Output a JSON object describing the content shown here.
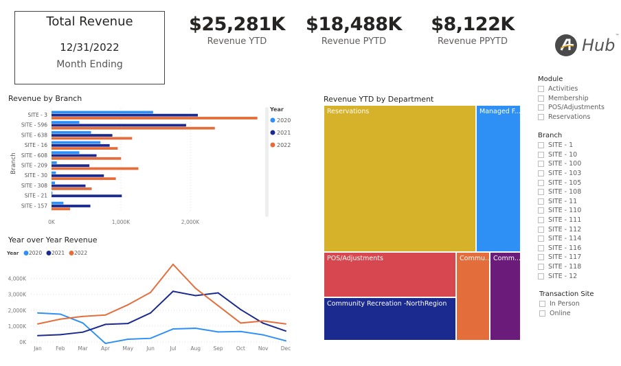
{
  "card": {
    "title": "Total Revenue",
    "date": "12/31/2022",
    "label": "Month Ending"
  },
  "kpis": [
    {
      "value": "$25,281K",
      "label": "Revenue YTD"
    },
    {
      "value": "$18,488K",
      "label": "Revenue PYTD"
    },
    {
      "value": "$8,122K",
      "label": "Revenue PPYTD"
    }
  ],
  "logo": {
    "text": "Hub",
    "tm": "™"
  },
  "colors": {
    "2020": "#2E90F5",
    "2021": "#1B2A8E",
    "2022": "#E46D3C"
  },
  "chart_data": [
    {
      "type": "bar",
      "title": "Revenue by Branch",
      "ylabel": "Branch",
      "legend_title": "Year",
      "legend": "right",
      "categories": [
        "SITE - 3",
        "SITE - 596",
        "SITE - 638",
        "SITE - 16",
        "SITE - 608",
        "SITE - 209",
        "SITE - 30",
        "SITE - 308",
        "SITE - 21",
        "SITE - 157"
      ],
      "series": [
        {
          "name": "2020",
          "values": [
            1464,
            401,
            570,
            705,
            401,
            76,
            63,
            50,
            13,
            172
          ]
        },
        {
          "name": "2021",
          "values": [
            2109,
            1940,
            877,
            838,
            649,
            546,
            755,
            490,
            1013,
            560
          ]
        },
        {
          "name": "2022",
          "values": [
            2967,
            2354,
            1162,
            954,
            1003,
            1252,
            927,
            579,
            0,
            268
          ]
        }
      ],
      "xticks": [
        "0K",
        "1,000K",
        "2,000K"
      ],
      "xlim": [
        0,
        3000
      ]
    },
    {
      "type": "line",
      "title": "Year over Year Revenue",
      "legend_title": "Year",
      "legend": "top-left",
      "categories": [
        "Jan",
        "Feb",
        "Mar",
        "Apr",
        "May",
        "Jun",
        "Jul",
        "Aug",
        "Sep",
        "Oct",
        "Nov",
        "Dec"
      ],
      "series": [
        {
          "name": "2020",
          "values": [
            1827,
            1755,
            1194,
            -90,
            173,
            230,
            820,
            863,
            633,
            662,
            446,
            72
          ]
        },
        {
          "name": "2021",
          "values": [
            403,
            460,
            619,
            1108,
            1165,
            1827,
            3194,
            2921,
            3094,
            2043,
            1180,
            691
          ]
        },
        {
          "name": "2022",
          "values": [
            1137,
            1439,
            1612,
            1698,
            2345,
            3122,
            4892,
            3381,
            2288,
            1194,
            1324,
            1137
          ]
        }
      ],
      "yticks": [
        "0K",
        "1,000K",
        "2,000K",
        "3,000K",
        "4,000K"
      ],
      "ylim": [
        0,
        4000
      ]
    },
    {
      "type": "treemap",
      "title": "Revenue YTD by Department",
      "items": [
        {
          "label": "Reservations",
          "color": "#D6B12A"
        },
        {
          "label": "Managed F...",
          "color": "#2E90F5"
        },
        {
          "label": "POS/Adjustments",
          "color": "#D6474F"
        },
        {
          "label": "Community Recreation -NorthRegion",
          "color": "#1B2A8E"
        },
        {
          "label": "Commu...",
          "color": "#E46D3C"
        },
        {
          "label": "Comm...",
          "color": "#6B1B7A"
        }
      ]
    }
  ],
  "slicers": {
    "module": {
      "title": "Module",
      "items": [
        "Activities",
        "Membership",
        "POS/Adjustments",
        "Reservations"
      ]
    },
    "branch": {
      "title": "Branch",
      "items": [
        "SITE - 1",
        "SITE - 10",
        "SITE - 100",
        "SITE - 103",
        "SITE - 105",
        "SITE - 108",
        "SITE - 11",
        "SITE - 110",
        "SITE - 111",
        "SITE - 112",
        "SITE - 114",
        "SITE - 116",
        "SITE - 117",
        "SITE - 118",
        "SITE - 12"
      ]
    },
    "site": {
      "title": "Transaction Site",
      "items": [
        "In Person",
        "Online"
      ]
    }
  }
}
